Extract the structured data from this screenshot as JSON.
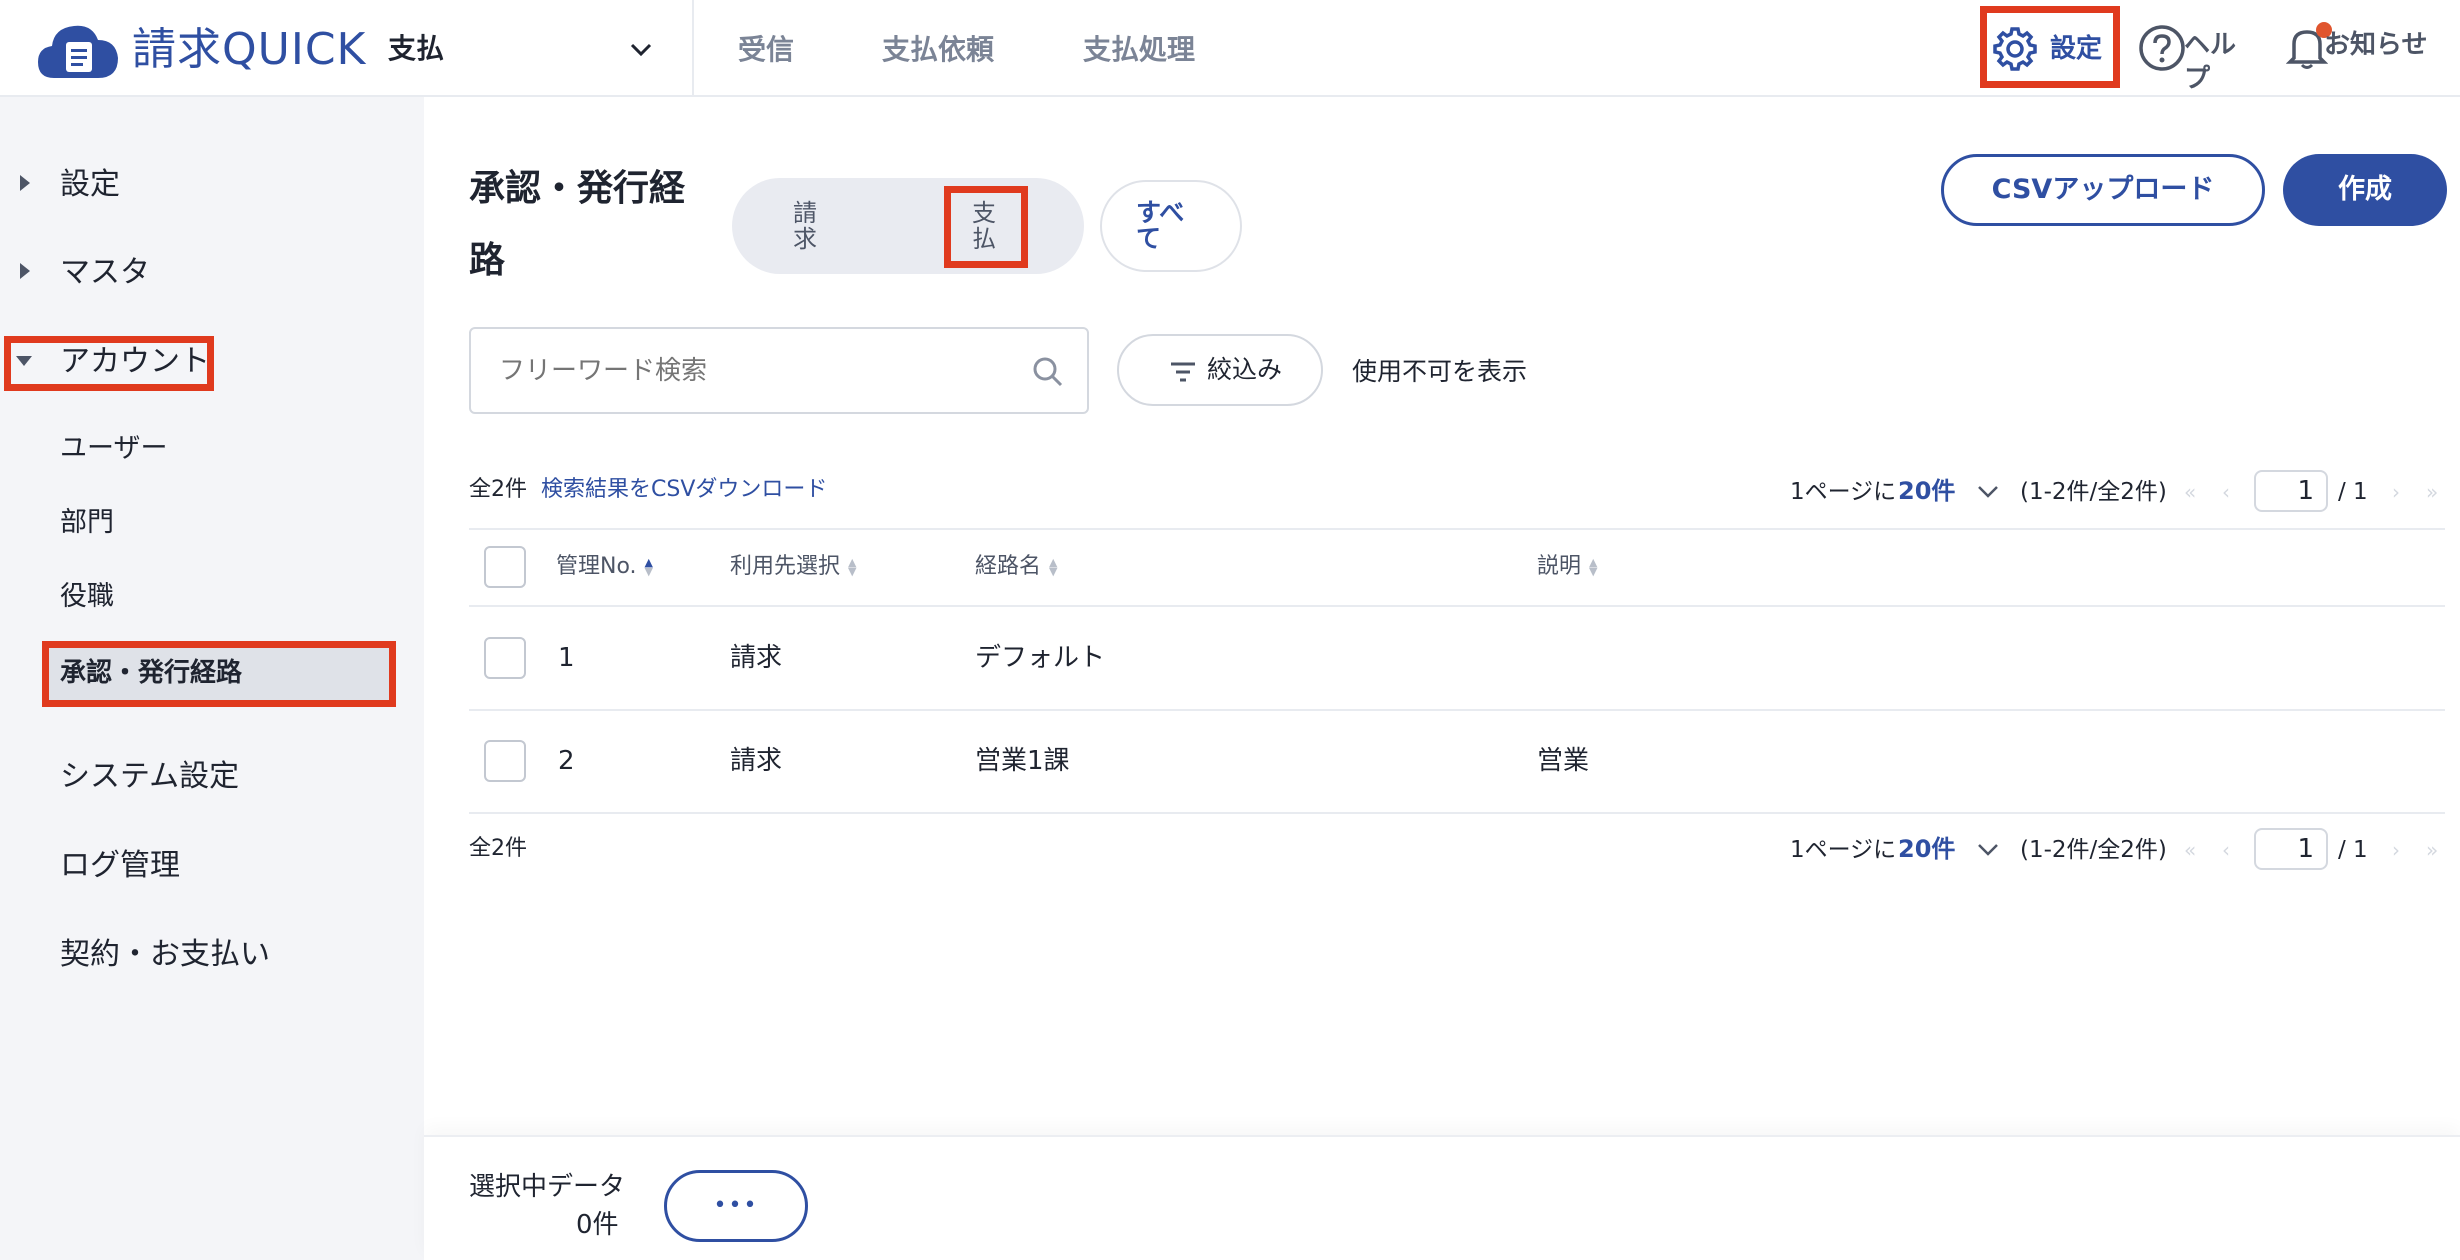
{
  "header": {
    "logo_text": "請求QUICK",
    "module_selector": "支払",
    "nav": [
      "受信",
      "支払依頼",
      "支払処理"
    ],
    "settings_label": "設定",
    "help_label": "ヘルプ",
    "notifications_label": "お知らせ"
  },
  "sidebar": {
    "settings": "設定",
    "master": "マスタ",
    "account": "アカウント",
    "account_items": [
      "ユーザー",
      "部門",
      "役職",
      "承認・発行経路"
    ],
    "system_settings": "システム設定",
    "log_management": "ログ管理",
    "contract": "契約・お支払い"
  },
  "main": {
    "title_line1": "承認・発行経",
    "title_line2": "路",
    "segment": {
      "invoice": "請求",
      "payment": "支払",
      "all": "すべ\nて"
    },
    "csv_upload": "CSVアップロード",
    "create": "作成",
    "search_placeholder": "フリーワード検索",
    "filter_label": "絞込み",
    "show_disabled": "使用不可を表示",
    "count_label": "全2件",
    "csv_download": "検索結果をCSVダウンロード",
    "pagination": {
      "per_page_prefix": "1ページに",
      "per_page_value": "20件",
      "range": "(1-2件/全2件)",
      "current_page": "1",
      "total_pages": "/ 1"
    },
    "columns": [
      "管理No.",
      "利用先選択",
      "経路名",
      "説明"
    ],
    "rows": [
      {
        "no": "1",
        "usage": "請求",
        "name": "デフォルト",
        "desc": ""
      },
      {
        "no": "2",
        "usage": "請求",
        "name": "営業1課",
        "desc": "営業"
      }
    ]
  },
  "footer": {
    "selected_label": "選択中データ",
    "selected_count": "0件",
    "more_button": "•••"
  },
  "colors": {
    "primary": "#2f4fa2",
    "highlight": "#e03a1e",
    "sidebar_bg": "#f4f5f8"
  }
}
